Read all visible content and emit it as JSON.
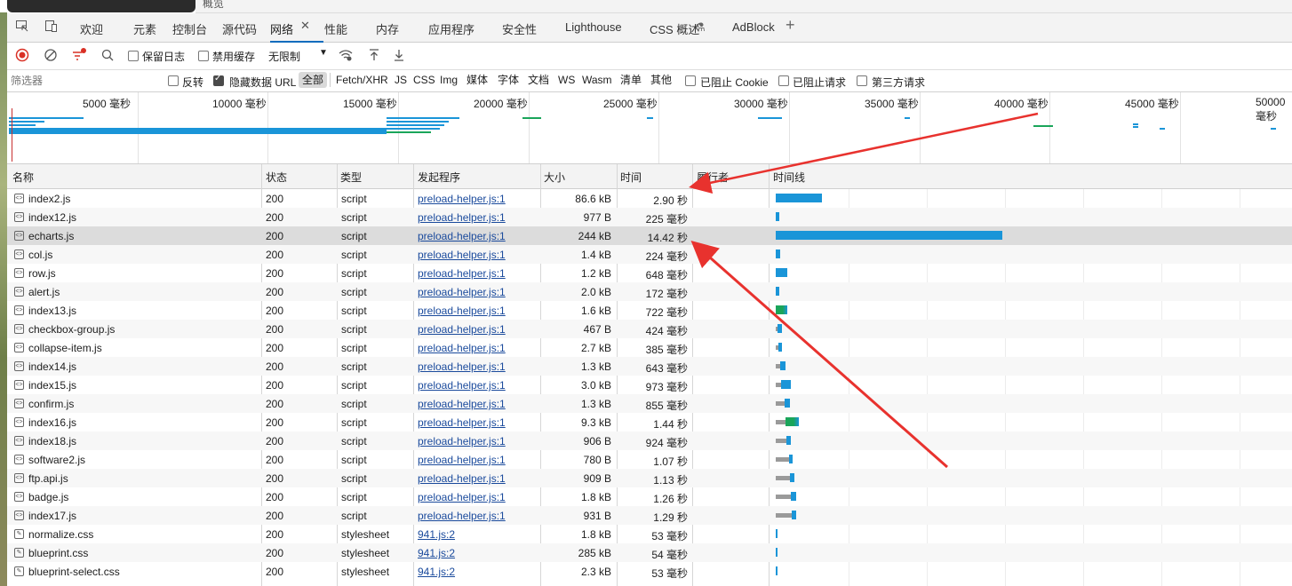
{
  "top": {
    "partial_title": "概览"
  },
  "tabs": [
    {
      "label": "欢迎"
    },
    {
      "label": "元素"
    },
    {
      "label": "控制台"
    },
    {
      "label": "源代码"
    },
    {
      "label": "网络",
      "active": true
    },
    {
      "label": "性能"
    },
    {
      "label": "内存"
    },
    {
      "label": "应用程序"
    },
    {
      "label": "安全性"
    },
    {
      "label": "Lighthouse"
    },
    {
      "label": "CSS 概述"
    },
    {
      "label": "AdBlock"
    }
  ],
  "toolbar": {
    "preserve_log": "保留日志",
    "disable_cache": "禁用缓存",
    "throttle": "无限制"
  },
  "filterbar": {
    "placeholder": "筛选器",
    "invert": "反转",
    "hide_data_url": "隐藏数据 URL",
    "types": [
      "全部",
      "Fetch/XHR",
      "JS",
      "CSS",
      "Img",
      "媒体",
      "字体",
      "文档",
      "WS",
      "Wasm",
      "清单",
      "其他"
    ],
    "blocked_cookie": "已阻止 Cookie",
    "blocked_requests": "已阻止请求",
    "third_party": "第三方请求"
  },
  "overview_ticks": [
    "5000 毫秒",
    "10000 毫秒",
    "15000 毫秒",
    "20000 毫秒",
    "25000 毫秒",
    "30000 毫秒",
    "35000 毫秒",
    "40000 毫秒",
    "45000 毫秒",
    "50000 毫秒"
  ],
  "columns": {
    "name": "名称",
    "status": "状态",
    "type": "类型",
    "initiator": "发起程序",
    "size": "大小",
    "time": "时间",
    "fulfilled": "履行者",
    "waterfall": "时间线"
  },
  "rows": [
    {
      "name": "index2.js",
      "status": "200",
      "type": "script",
      "initiator": "preload-helper.js:1",
      "size": "86.6 kB",
      "time": "2.90 秒",
      "wf_start": 0.3,
      "wf_wait": 0,
      "wf_recv": 5.2
    },
    {
      "name": "index12.js",
      "status": "200",
      "type": "script",
      "initiator": "preload-helper.js:1",
      "size": "977 B",
      "time": "225 毫秒",
      "wf_start": 0.3,
      "wf_wait": 0,
      "wf_recv": 0.4
    },
    {
      "name": "echarts.js",
      "status": "200",
      "type": "script",
      "initiator": "preload-helper.js:1",
      "size": "244 kB",
      "time": "14.42 秒",
      "wf_start": 0.3,
      "wf_wait": 0,
      "wf_recv": 25.5,
      "selected": true
    },
    {
      "name": "col.js",
      "status": "200",
      "type": "script",
      "initiator": "preload-helper.js:1",
      "size": "1.4 kB",
      "time": "224 毫秒",
      "wf_start": 0.3,
      "wf_wait": 0,
      "wf_recv": 0.5
    },
    {
      "name": "row.js",
      "status": "200",
      "type": "script",
      "initiator": "preload-helper.js:1",
      "size": "1.2 kB",
      "time": "648 毫秒",
      "wf_start": 0.3,
      "wf_wait": 0,
      "wf_recv": 1.3
    },
    {
      "name": "alert.js",
      "status": "200",
      "type": "script",
      "initiator": "preload-helper.js:1",
      "size": "2.0 kB",
      "time": "172 毫秒",
      "wf_start": 0.3,
      "wf_wait": 0,
      "wf_recv": 0.4
    },
    {
      "name": "index13.js",
      "status": "200",
      "type": "script",
      "initiator": "preload-helper.js:1",
      "size": "1.6 kB",
      "time": "722 毫秒",
      "wf_start": 0.3,
      "wf_wait": 0,
      "wf_recv": 1.3,
      "green": true
    },
    {
      "name": "checkbox-group.js",
      "status": "200",
      "type": "script",
      "initiator": "preload-helper.js:1",
      "size": "467 B",
      "time": "424 毫秒",
      "wf_start": 0.3,
      "wf_wait": 0.2,
      "wf_recv": 0.5
    },
    {
      "name": "collapse-item.js",
      "status": "200",
      "type": "script",
      "initiator": "preload-helper.js:1",
      "size": "2.7 kB",
      "time": "385 毫秒",
      "wf_start": 0.3,
      "wf_wait": 0.3,
      "wf_recv": 0.4
    },
    {
      "name": "index14.js",
      "status": "200",
      "type": "script",
      "initiator": "preload-helper.js:1",
      "size": "1.3 kB",
      "time": "643 毫秒",
      "wf_start": 0.3,
      "wf_wait": 0.5,
      "wf_recv": 0.6
    },
    {
      "name": "index15.js",
      "status": "200",
      "type": "script",
      "initiator": "preload-helper.js:1",
      "size": "3.0 kB",
      "time": "973 毫秒",
      "wf_start": 0.3,
      "wf_wait": 0.6,
      "wf_recv": 1.1
    },
    {
      "name": "confirm.js",
      "status": "200",
      "type": "script",
      "initiator": "preload-helper.js:1",
      "size": "1.3 kB",
      "time": "855 毫秒",
      "wf_start": 0.3,
      "wf_wait": 1.0,
      "wf_recv": 0.6
    },
    {
      "name": "index16.js",
      "status": "200",
      "type": "script",
      "initiator": "preload-helper.js:1",
      "size": "9.3 kB",
      "time": "1.44 秒",
      "wf_start": 0.3,
      "wf_wait": 1.1,
      "wf_recv": 1.5,
      "green": true
    },
    {
      "name": "index18.js",
      "status": "200",
      "type": "script",
      "initiator": "preload-helper.js:1",
      "size": "906 B",
      "time": "924 毫秒",
      "wf_start": 0.3,
      "wf_wait": 1.2,
      "wf_recv": 0.5
    },
    {
      "name": "software2.js",
      "status": "200",
      "type": "script",
      "initiator": "preload-helper.js:1",
      "size": "780 B",
      "time": "1.07 秒",
      "wf_start": 0.3,
      "wf_wait": 1.5,
      "wf_recv": 0.4
    },
    {
      "name": "ftp.api.js",
      "status": "200",
      "type": "script",
      "initiator": "preload-helper.js:1",
      "size": "909 B",
      "time": "1.13 秒",
      "wf_start": 0.3,
      "wf_wait": 1.6,
      "wf_recv": 0.5
    },
    {
      "name": "badge.js",
      "status": "200",
      "type": "script",
      "initiator": "preload-helper.js:1",
      "size": "1.8 kB",
      "time": "1.26 秒",
      "wf_start": 0.3,
      "wf_wait": 1.7,
      "wf_recv": 0.6
    },
    {
      "name": "index17.js",
      "status": "200",
      "type": "script",
      "initiator": "preload-helper.js:1",
      "size": "931 B",
      "time": "1.29 秒",
      "wf_start": 0.3,
      "wf_wait": 1.8,
      "wf_recv": 0.5
    },
    {
      "name": "normalize.css",
      "status": "200",
      "type": "stylesheet",
      "initiator": "941.js:2",
      "size": "1.8 kB",
      "time": "53 毫秒",
      "wf_start": 0.3,
      "wf_wait": 0,
      "wf_recv": 0.2,
      "css": true
    },
    {
      "name": "blueprint.css",
      "status": "200",
      "type": "stylesheet",
      "initiator": "941.js:2",
      "size": "285 kB",
      "time": "54 毫秒",
      "wf_start": 0.3,
      "wf_wait": 0,
      "wf_recv": 0.2,
      "css": true
    },
    {
      "name": "blueprint-select.css",
      "status": "200",
      "type": "stylesheet",
      "initiator": "941.js:2",
      "size": "2.3 kB",
      "time": "53 毫秒",
      "wf_start": 0.3,
      "wf_wait": 0,
      "wf_recv": 0.2,
      "css": true
    }
  ],
  "colors": {
    "accent": "#0f6cbd",
    "bar_blue": "#1a95d8",
    "bar_green": "#1aa55a",
    "bar_wait": "#9a9a9a",
    "arrow": "#e8322e"
  }
}
